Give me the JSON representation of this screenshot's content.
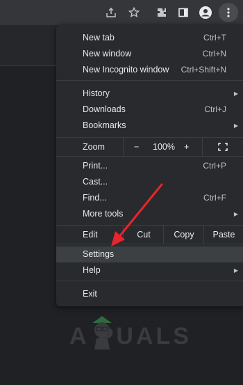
{
  "toolbar": {
    "icons": [
      "share-icon",
      "star-icon",
      "extensions-icon",
      "side-panel-icon",
      "profile-icon",
      "menu-icon"
    ]
  },
  "menu": {
    "new_tab": {
      "label": "New tab",
      "shortcut": "Ctrl+T"
    },
    "new_window": {
      "label": "New window",
      "shortcut": "Ctrl+N"
    },
    "incognito": {
      "label": "New Incognito window",
      "shortcut": "Ctrl+Shift+N"
    },
    "history": {
      "label": "History"
    },
    "downloads": {
      "label": "Downloads",
      "shortcut": "Ctrl+J"
    },
    "bookmarks": {
      "label": "Bookmarks"
    },
    "zoom": {
      "label": "Zoom",
      "minus": "−",
      "value": "100%",
      "plus": "+"
    },
    "print": {
      "label": "Print...",
      "shortcut": "Ctrl+P"
    },
    "cast": {
      "label": "Cast..."
    },
    "find": {
      "label": "Find...",
      "shortcut": "Ctrl+F"
    },
    "more_tools": {
      "label": "More tools"
    },
    "edit": {
      "label": "Edit",
      "cut": "Cut",
      "copy": "Copy",
      "paste": "Paste"
    },
    "settings": {
      "label": "Settings"
    },
    "help": {
      "label": "Help"
    },
    "exit": {
      "label": "Exit"
    }
  },
  "watermark": {
    "text": "A PUALS"
  },
  "colors": {
    "menu_bg": "#292a2d",
    "highlight": "#3c4043",
    "arrow": "#e8252b",
    "text": "#e8eaed"
  }
}
